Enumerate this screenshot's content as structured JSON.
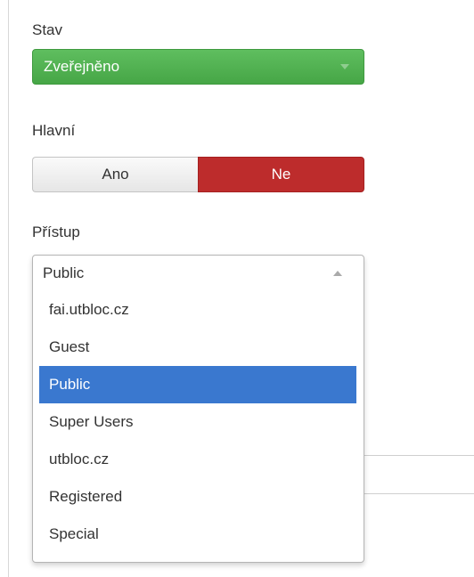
{
  "status": {
    "label": "Stav",
    "value": "Zveřejněno",
    "color": "#4cae4c"
  },
  "featured": {
    "label": "Hlavní",
    "yes_label": "Ano",
    "no_label": "Ne",
    "selected": "Ne",
    "active_color": "#bd2c2c"
  },
  "access": {
    "label": "Přístup",
    "value": "Public",
    "options": [
      "fai.utbloc.cz",
      "Guest",
      "Public",
      "Super Users",
      "utbloc.cz",
      "Registered",
      "Special"
    ],
    "selected_index": 2,
    "highlight_color": "#3a78cf"
  }
}
